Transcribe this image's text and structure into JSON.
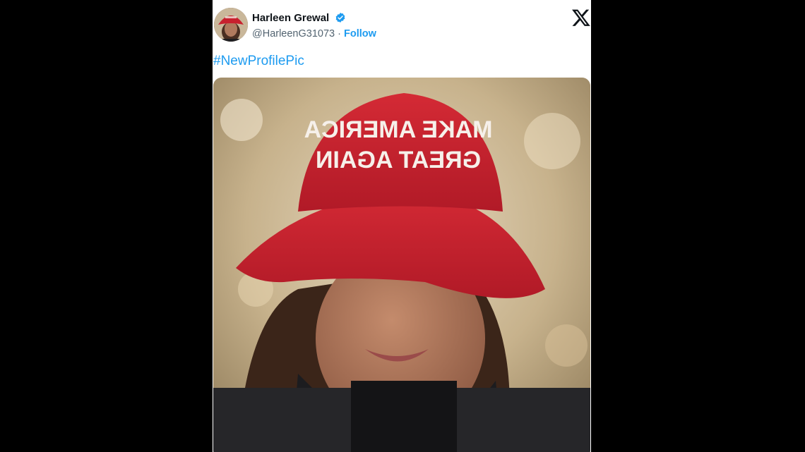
{
  "tweet": {
    "author": {
      "display_name": "Harleen Grewal",
      "handle": "@HarleenG31073",
      "separator": "·",
      "follow_label": "Follow",
      "verified": true,
      "verified_icon": "verified-badge-icon"
    },
    "platform_icon": "x-logo-icon",
    "text": "#NewProfilePic",
    "media": {
      "hat_text_line1": "MAKE AMERICA",
      "hat_text_line2": "GREAT AGAIN"
    }
  },
  "colors": {
    "background": "#000000",
    "card": "#ffffff",
    "link": "#1d9bf0",
    "name": "#0f1419",
    "secondary": "#536471",
    "hat": "#c8202e"
  }
}
